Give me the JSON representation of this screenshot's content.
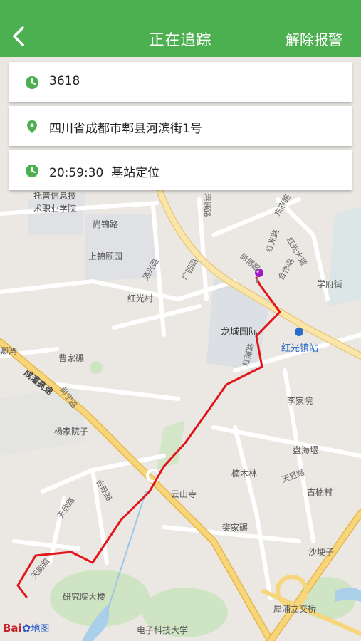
{
  "header": {
    "title": "正在追踪",
    "action_label": "解除报警",
    "colors": {
      "bar": "#4caf50",
      "text": "#ffffff"
    }
  },
  "info": {
    "device_id": "3618",
    "address": "四川省成都市郫县河滨街1号",
    "time": "20:59:30",
    "locate_method": "基站定位",
    "icon_color": "#4caf50"
  },
  "map": {
    "labels": {
      "tuopu": "托普信息技",
      "tuopu2": "术职业学院",
      "shangjin_rd": "尚锦路",
      "shangjin_yuan": "上锦颐园",
      "hongguang_village": "红光村",
      "longcheng": "龙城国际",
      "hongguang_station": "红光镇站",
      "caojia": "曹家碾",
      "chengguan": "成灌高速",
      "yangjia": "杨家院子",
      "lijia": "李家院",
      "panhai": "盘海堰",
      "nanmulin": "楠木林",
      "yunshan": "云山寺",
      "gunan": "古楠村",
      "fanjia": "樊家碾",
      "shageng": "沙埂子",
      "yanjiuyuan": "研究院大楼",
      "xipu_bridge": "犀浦立交桥",
      "dianzi": "电子科技大学",
      "xuefu": "学府街",
      "qingwan": "卿湾"
    },
    "roads": {
      "gangtong": "港通路",
      "hongguang_ave": "红光大道",
      "hongguang_rd": "红光路",
      "shangbo": "尚博路",
      "hehe": "合作路",
      "tianyun": "天韵路",
      "tianxin": "天欣路",
      "hewang": "合旺路",
      "tianyu": "天昱路",
      "dongfu": "东府路",
      "tongxing": "通兴路",
      "guangyuan": "广园路",
      "hongpu": "红浦路",
      "shangning": "尚宁路"
    },
    "track_color": "#e0161b",
    "marker_color": "#9c1bc2"
  },
  "logo": {
    "brand": "Bai",
    "suffix": "地图"
  }
}
